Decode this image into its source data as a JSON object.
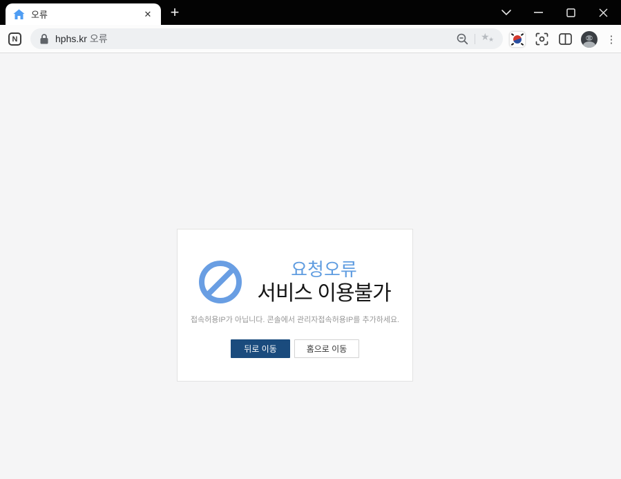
{
  "window": {
    "tab_title": "오류"
  },
  "toolbar": {
    "url_domain": "hphs.kr",
    "url_suffix": "오류"
  },
  "error_card": {
    "title": "요청오류",
    "subtitle": "서비스 이용불가",
    "description": "접속허용IP가 아닙니다. 콘솔에서 관리자접속허용IP를 추가하세요.",
    "buttons": {
      "back": "뒤로 이동",
      "home": "홈으로 이동"
    }
  },
  "icons": {
    "tab_close": "✕",
    "new_tab": "+",
    "whale_logo": "N",
    "star_big": "★",
    "star_small": "★",
    "menu": "⋮"
  },
  "colors": {
    "titlebar_bg": "#030303",
    "accent_blue": "#699ee3",
    "title_blue": "#5f9ce0",
    "primary_button_bg": "#1a4b7d",
    "content_bg": "#f5f5f6",
    "card_bg": "#ffffff"
  }
}
